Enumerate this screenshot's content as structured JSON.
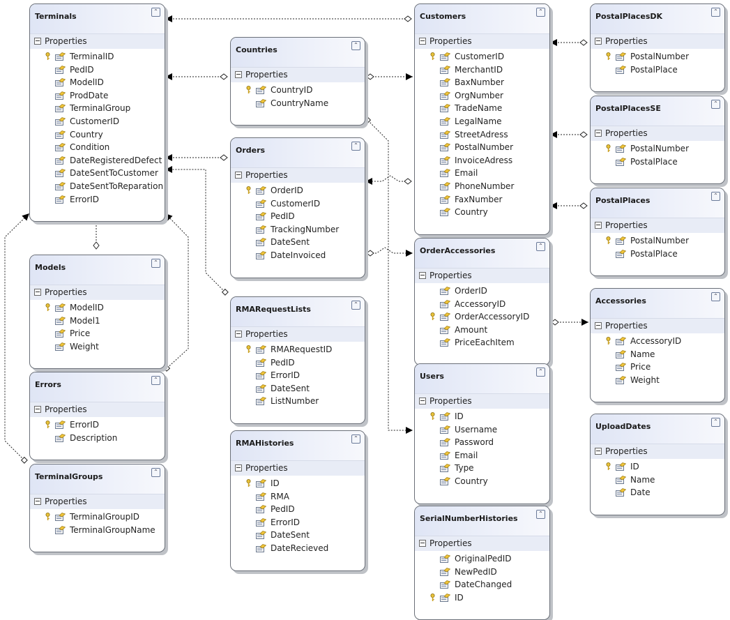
{
  "properties_label": "Properties",
  "entities": [
    {
      "name": "Terminals",
      "fields": [
        {
          "n": "TerminalID",
          "key": true
        },
        {
          "n": "PedID"
        },
        {
          "n": "ModelID"
        },
        {
          "n": "ProdDate"
        },
        {
          "n": "TerminalGroup"
        },
        {
          "n": "CustomerID"
        },
        {
          "n": "Country"
        },
        {
          "n": "Condition"
        },
        {
          "n": "DateRegisteredDefect"
        },
        {
          "n": "DateSentToCustomer"
        },
        {
          "n": "DateSentToReparation"
        },
        {
          "n": "ErrorID"
        }
      ]
    },
    {
      "name": "Countries",
      "fields": [
        {
          "n": "CountryID",
          "key": true
        },
        {
          "n": "CountryName"
        }
      ]
    },
    {
      "name": "Customers",
      "fields": [
        {
          "n": "CustomerID",
          "key": true
        },
        {
          "n": "MerchantID"
        },
        {
          "n": "BaxNumber"
        },
        {
          "n": "OrgNumber"
        },
        {
          "n": "TradeName"
        },
        {
          "n": "LegalName"
        },
        {
          "n": "StreetAdress"
        },
        {
          "n": "PostalNumber"
        },
        {
          "n": "InvoiceAdress"
        },
        {
          "n": "Email"
        },
        {
          "n": "PhoneNumber"
        },
        {
          "n": "FaxNumber"
        },
        {
          "n": "Country"
        }
      ]
    },
    {
      "name": "PostalPlacesDK",
      "fields": [
        {
          "n": "PostalNumber",
          "key": true
        },
        {
          "n": "PostalPlace"
        }
      ]
    },
    {
      "name": "PostalPlacesSE",
      "fields": [
        {
          "n": "PostalNumber",
          "key": true
        },
        {
          "n": "PostalPlace"
        }
      ]
    },
    {
      "name": "PostalPlaces",
      "fields": [
        {
          "n": "PostalNumber",
          "key": true
        },
        {
          "n": "PostalPlace"
        }
      ]
    },
    {
      "name": "Orders",
      "fields": [
        {
          "n": "OrderID",
          "key": true
        },
        {
          "n": "CustomerID"
        },
        {
          "n": "PedID"
        },
        {
          "n": "TrackingNumber"
        },
        {
          "n": "DateSent"
        },
        {
          "n": "DateInvoiced"
        }
      ]
    },
    {
      "name": "OrderAccessories",
      "fields": [
        {
          "n": "OrderID"
        },
        {
          "n": "AccessoryID"
        },
        {
          "n": "OrderAccessoryID",
          "key": true
        },
        {
          "n": "Amount"
        },
        {
          "n": "PriceEachItem"
        }
      ]
    },
    {
      "name": "Accessories",
      "fields": [
        {
          "n": "AccessoryID",
          "key": true
        },
        {
          "n": "Name"
        },
        {
          "n": "Price"
        },
        {
          "n": "Weight"
        }
      ]
    },
    {
      "name": "Models",
      "fields": [
        {
          "n": "ModelID",
          "key": true
        },
        {
          "n": "Model1"
        },
        {
          "n": "Price"
        },
        {
          "n": "Weight"
        }
      ]
    },
    {
      "name": "Errors",
      "fields": [
        {
          "n": "ErrorID",
          "key": true
        },
        {
          "n": "Description"
        }
      ]
    },
    {
      "name": "TerminalGroups",
      "fields": [
        {
          "n": "TerminalGroupID",
          "key": true
        },
        {
          "n": "TerminalGroupName"
        }
      ]
    },
    {
      "name": "RMARequestLists",
      "fields": [
        {
          "n": "RMARequestID",
          "key": true
        },
        {
          "n": "PedID"
        },
        {
          "n": "ErrorID"
        },
        {
          "n": "DateSent"
        },
        {
          "n": "ListNumber"
        }
      ]
    },
    {
      "name": "RMAHistories",
      "fields": [
        {
          "n": "ID",
          "key": true
        },
        {
          "n": "RMA"
        },
        {
          "n": "PedID"
        },
        {
          "n": "ErrorID"
        },
        {
          "n": "DateSent"
        },
        {
          "n": "DateRecieved"
        }
      ]
    },
    {
      "name": "Users",
      "fields": [
        {
          "n": "ID",
          "key": true
        },
        {
          "n": "Username"
        },
        {
          "n": "Password"
        },
        {
          "n": "Email"
        },
        {
          "n": "Type"
        },
        {
          "n": "Country"
        }
      ]
    },
    {
      "name": "SerialNumberHistories",
      "fields": [
        {
          "n": "OriginalPedID"
        },
        {
          "n": "NewPedID"
        },
        {
          "n": "DateChanged"
        },
        {
          "n": "ID",
          "key": true
        }
      ]
    },
    {
      "name": "UploadDates",
      "fields": [
        {
          "n": "ID",
          "key": true
        },
        {
          "n": "Name"
        },
        {
          "n": "Date"
        }
      ]
    }
  ],
  "associations": [
    {
      "from": "Customers",
      "to": "Terminals"
    },
    {
      "from": "Countries",
      "to": "Terminals"
    },
    {
      "from": "Countries",
      "to": "Customers"
    },
    {
      "from": "PostalPlacesDK",
      "to": "Customers"
    },
    {
      "from": "PostalPlacesSE",
      "to": "Customers"
    },
    {
      "from": "PostalPlaces",
      "to": "Customers"
    },
    {
      "from": "Orders",
      "to": "Terminals"
    },
    {
      "from": "Customers",
      "to": "Orders"
    },
    {
      "from": "Orders",
      "to": "OrderAccessories"
    },
    {
      "from": "OrderAccessories",
      "to": "Accessories"
    },
    {
      "from": "Models",
      "to": "Terminals"
    },
    {
      "from": "Errors",
      "to": "Terminals"
    },
    {
      "from": "TerminalGroups",
      "to": "Terminals"
    },
    {
      "from": "RMARequestLists",
      "to": "Terminals"
    },
    {
      "from": "Countries",
      "to": "Users"
    }
  ],
  "colors": {
    "header": "#dfe5f5",
    "border": "#6a6f78",
    "link": "#222222"
  }
}
